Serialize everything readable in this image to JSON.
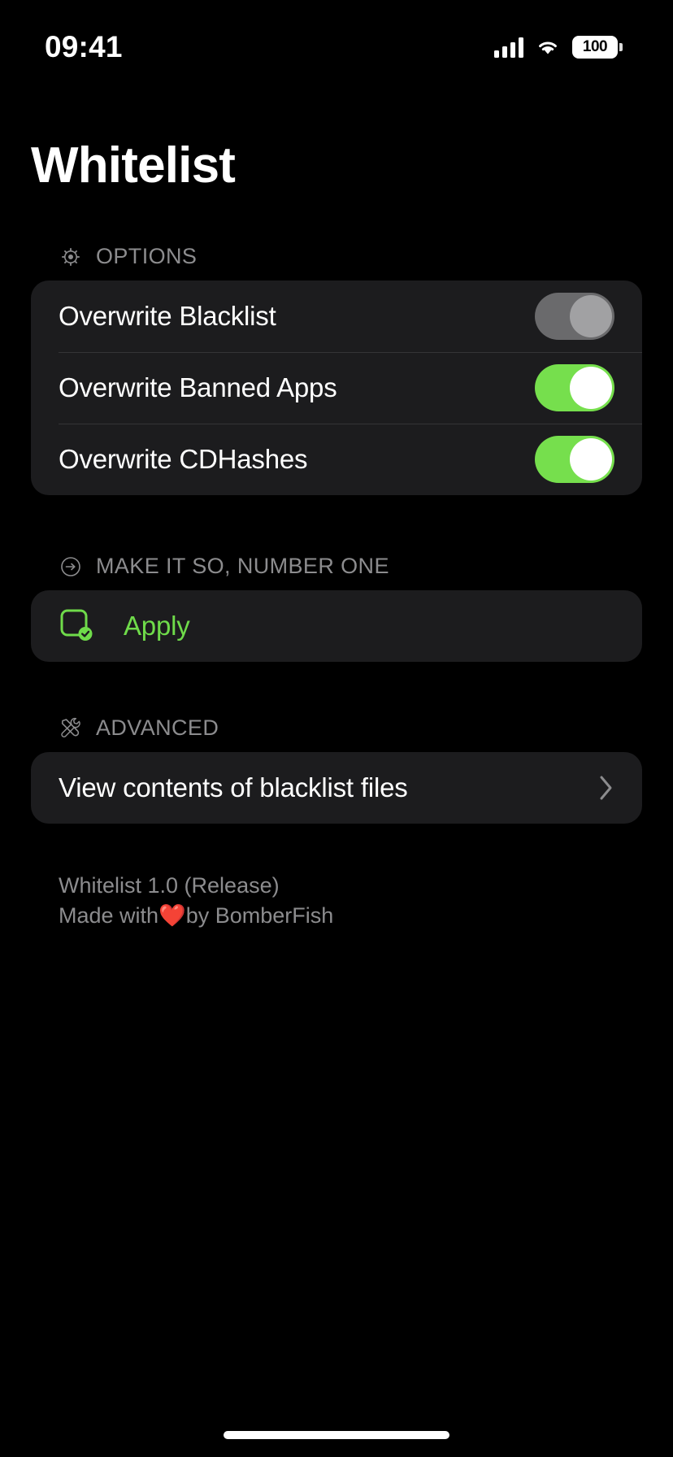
{
  "status_bar": {
    "time": "09:41",
    "cellular_icon": "cellular-bars-icon",
    "wifi_icon": "wifi-icon",
    "battery_percent": "100",
    "battery_icon": "battery-full-icon"
  },
  "header": {
    "title": "Whitelist"
  },
  "sections": [
    {
      "id": "options",
      "header_label": "OPTIONS",
      "header_icon": "gear-icon",
      "rows": [
        {
          "label": "Overwrite Blacklist",
          "control": "toggle",
          "state": "off"
        },
        {
          "label": "Overwrite Banned Apps",
          "control": "toggle",
          "state": "on"
        },
        {
          "label": "Overwrite CDHashes",
          "control": "toggle",
          "state": "on"
        }
      ]
    },
    {
      "id": "apply",
      "header_label": "MAKE IT SO, NUMBER ONE",
      "header_icon": "arrow-right-circle-icon",
      "rows": [
        {
          "label": "Apply",
          "control": "button",
          "icon": "app-checkmark-icon"
        }
      ]
    },
    {
      "id": "advanced",
      "header_label": "ADVANCED",
      "header_icon": "wrench-screwdriver-icon",
      "rows": [
        {
          "label": "View contents of blacklist files",
          "control": "disclosure",
          "icon": "chevron-right-icon"
        }
      ]
    }
  ],
  "footer": {
    "version": "Whitelist 1.0 (Release)",
    "credit_prefix": "Made with ",
    "credit_heart": "❤️",
    "credit_suffix": " by BomberFish"
  },
  "colors": {
    "background": "#000000",
    "card": "#1c1c1e",
    "accent_green": "#76df4d",
    "text_primary": "#ffffff",
    "text_secondary": "#8c8c8e",
    "toggle_off_track": "#6a6a6c",
    "heart_red": "#ff3b30"
  }
}
